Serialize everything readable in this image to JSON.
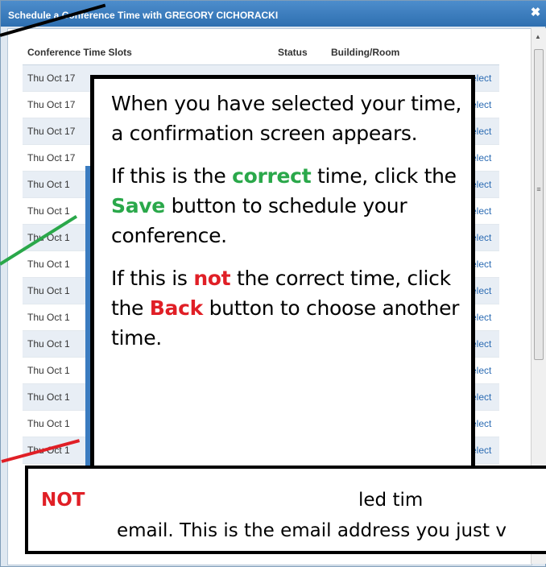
{
  "dialog": {
    "title": "Schedule a Conference Time with GREGORY CICHORACKI",
    "close_icon": "close-icon"
  },
  "table": {
    "headers": [
      "Conference Time Slots",
      "Status",
      "Building/Room",
      ""
    ],
    "rows": [
      {
        "slot": "Thu Oct 17",
        "select": "elect"
      },
      {
        "slot": "Thu Oct 17",
        "select": "elect"
      },
      {
        "slot": "Thu Oct 17",
        "select": "elect"
      },
      {
        "slot": "Thu Oct 17",
        "select": "elect"
      },
      {
        "slot": "Thu Oct 1",
        "select": "elect"
      },
      {
        "slot": "Thu Oct 1",
        "select": "elect"
      },
      {
        "slot": "Thu Oct 1",
        "select": "elect"
      },
      {
        "slot": "Thu Oct 1",
        "select": "elect"
      },
      {
        "slot": "Thu Oct 1",
        "select": "elect"
      },
      {
        "slot": "Thu Oct 1",
        "select": "elect"
      },
      {
        "slot": "Thu Oct 1",
        "select": "elect"
      },
      {
        "slot": "Thu Oct 1",
        "select": "elect"
      },
      {
        "slot": "Thu Oct 1",
        "select": "elect"
      },
      {
        "slot": "Thu Oct 1",
        "select": "elect"
      },
      {
        "slot": "Thu Oct 1",
        "select": "elect"
      }
    ]
  },
  "callout": {
    "p1": "When you have selected your time, a confirmation screen appears.",
    "p2_a": "If this is the ",
    "p2_correct": "correct",
    "p2_b": " time, click the ",
    "p2_save": "Save",
    "p2_c": " button to schedule your conference.",
    "p3_a": "If this is ",
    "p3_not": "not",
    "p3_b": " the correct time, click the ",
    "p3_back": "Back",
    "p3_c": " button to choose another time."
  },
  "note": {
    "label": "NOT",
    "text1": "led tim",
    "text2": "email. This is the email address you just v"
  },
  "colors": {
    "green": "#2aa84a",
    "red": "#e01f26",
    "title_blue": "#2e6fb0"
  }
}
